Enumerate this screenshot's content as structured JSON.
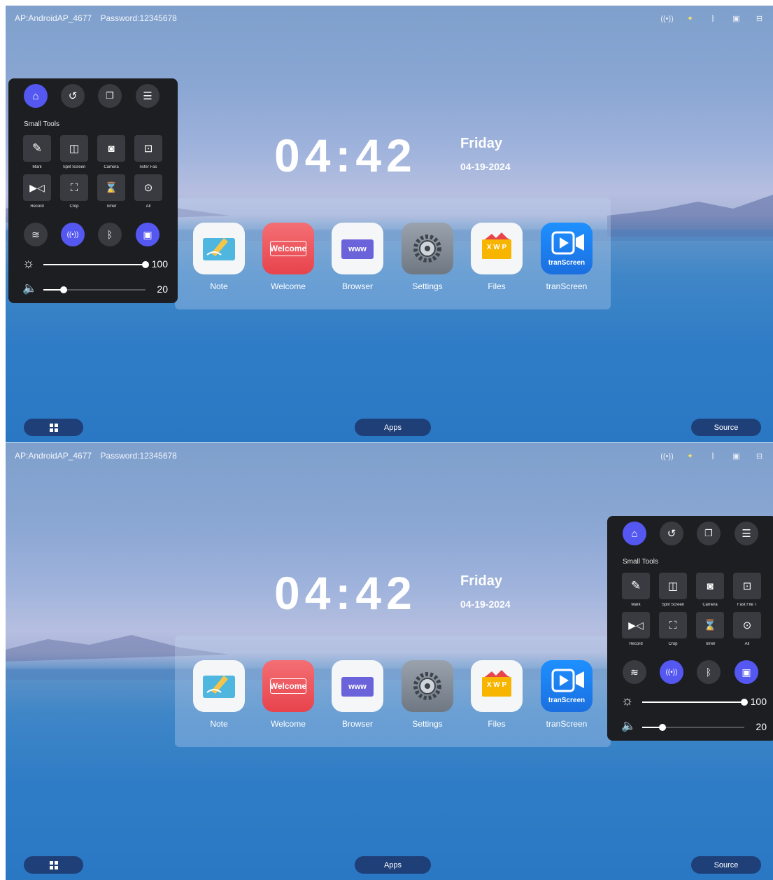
{
  "status_bar": {
    "ap": "AP:AndroidAP_4677",
    "password": "Password:12345678",
    "icons": [
      "hotspot-icon",
      "light-icon",
      "bluetooth-off-icon",
      "screen-icon",
      "usb-icon"
    ]
  },
  "clock": {
    "time": "04:42",
    "day": "Friday",
    "date": "04-19-2024"
  },
  "apps": [
    {
      "label": "Note",
      "icon": "note-icon"
    },
    {
      "label": "Welcome",
      "icon": "welcome-icon",
      "badge": "Welcome"
    },
    {
      "label": "Browser",
      "icon": "browser-icon",
      "badge": "www"
    },
    {
      "label": "Settings",
      "icon": "settings-gear-icon"
    },
    {
      "label": "Files",
      "icon": "files-icon",
      "badge": "X W P"
    },
    {
      "label": "tranScreen",
      "icon": "transcreen-icon",
      "badge": "tranScreen"
    }
  ],
  "bottom_bar": {
    "apps_label": "Apps",
    "source_label": "Source",
    "windows_icon": "windows-icon"
  },
  "panel": {
    "nav": [
      "home-icon",
      "back-icon",
      "recent-apps-icon",
      "menu-icon"
    ],
    "small_tools_title": "Small Tools",
    "tools_top": {
      "row1": [
        {
          "label": "Mark",
          "icon": "pen-icon"
        },
        {
          "label": "Split Screen",
          "icon": "split-screen-icon"
        },
        {
          "label": "Camera",
          "icon": "camera-icon"
        },
        {
          "label": "nsfer   Fas",
          "icon": "fast-transfer-icon"
        }
      ],
      "row2": [
        {
          "label": "Record",
          "icon": "record-icon"
        },
        {
          "label": "Crop",
          "icon": "crop-icon"
        },
        {
          "label": "Timer",
          "icon": "hourglass-icon"
        },
        {
          "label": "All",
          "icon": "more-icon"
        }
      ]
    },
    "tools_bottom": {
      "row1": [
        {
          "label": "Mark",
          "icon": "pen-icon"
        },
        {
          "label": "Split Screen",
          "icon": "split-screen-icon"
        },
        {
          "label": "Camera",
          "icon": "camera-icon"
        },
        {
          "label": "Fast File T",
          "icon": "fast-transfer-icon"
        }
      ],
      "row2": [
        {
          "label": "Record",
          "icon": "record-icon"
        },
        {
          "label": "Crop",
          "icon": "crop-icon"
        },
        {
          "label": "Timer",
          "icon": "hourglass-icon"
        },
        {
          "label": "All",
          "icon": "more-icon"
        }
      ]
    },
    "quick": [
      {
        "icon": "wifi-icon",
        "active": false
      },
      {
        "icon": "hotspot-icon",
        "active": true
      },
      {
        "icon": "bluetooth-icon",
        "active": false
      },
      {
        "icon": "screen-cast-icon",
        "active": true
      }
    ],
    "brightness": {
      "value": "100",
      "level": 1.0,
      "icon": "brightness-icon"
    },
    "volume": {
      "value": "20",
      "level": 0.2,
      "icon": "volume-icon"
    }
  },
  "colors": {
    "accent": "#5458f0",
    "panel_bg": "#1d1e22",
    "button_bg": "#3a3b41",
    "bar_btn": "#1e3f78"
  }
}
